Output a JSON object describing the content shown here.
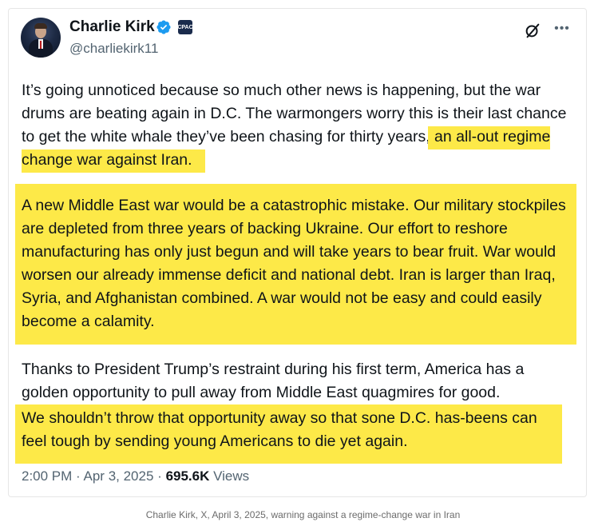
{
  "tweet": {
    "author": {
      "name": "Charlie Kirk",
      "handle": "@charliekirk11",
      "verified_badge": "blue-check-icon",
      "affiliate_badge": "affiliate-badge-icon",
      "affiliate_badge_text": "CPAC"
    },
    "paragraphs": {
      "p1_plain": "It’s going unnoticed because so much other news is happening, but the war drums are beating again in D.C. The warmongers worry this is their last chance to get the white whale they’ve been chasing for thirty years,",
      "p1_highlight": "an all-out regime change war against Iran.",
      "p2_highlight": "A new Middle East war would be a catastrophic mistake. Our military stockpiles are depleted from three years of backing Ukraine. Our effort to reshore manufacturing has only just begun and will take years to bear fruit. War would worsen our already immense deficit and national debt. Iran is larger than Iraq, Syria, and Afghanistan combined. A war would not be easy and could easily become a calamity.",
      "p3_plain": "Thanks to President Trump’s restraint during his first term, America has a golden opportunity to pull away from Middle East quagmires for good.",
      "p3_highlight": "We shouldn’t throw that opportunity away so that sone D.C. has-beens can feel tough by sending young Americans to die yet again."
    },
    "meta": {
      "time": "2:00 PM",
      "separator": "·",
      "date": "Apr 3, 2025",
      "views_count": "695.6K",
      "views_label": "Views"
    },
    "colors": {
      "highlight": "#fde948",
      "verified": "#1d9bf0",
      "secondary_text": "#536471"
    }
  },
  "caption": "Charlie Kirk, X, April 3, 2025, warning against a regime-change war in Iran"
}
